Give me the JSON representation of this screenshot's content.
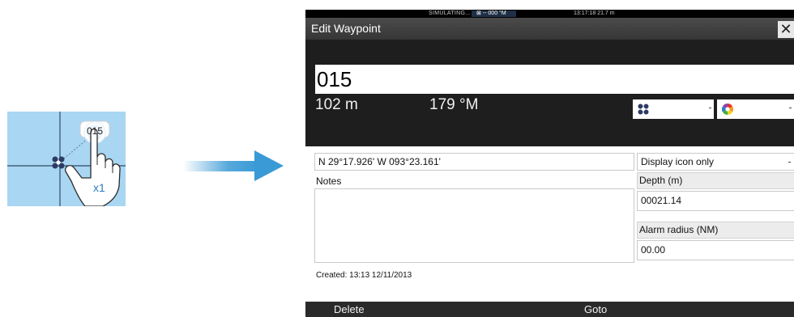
{
  "illustration": {
    "waypoint_label": "015",
    "tap_count": "x1"
  },
  "status_bar": {
    "mode": "SIMULATING...",
    "gps": "⊠ -- 000 °M",
    "time_depth": "13:17:18  21.7 m"
  },
  "dialog": {
    "title": "Edit Waypoint",
    "close_label": "✕",
    "name": "015",
    "distance": "102 m",
    "bearing": "179 °M",
    "icon_dropdown": {
      "icon": "waypoint-icon"
    },
    "color_dropdown": {
      "icon": "color-wheel-icon"
    },
    "position": "N 29°17.926'  W 093°23.161'",
    "notes_label": "Notes",
    "notes_value": "",
    "created": "Created: 13:13  12/11/2013",
    "display_mode": "Display icon only",
    "depth_label": "Depth (m)",
    "depth_value": "00021.14",
    "alarm_label": "Alarm radius (NM)",
    "alarm_value": "00.00"
  },
  "footer": {
    "delete_label": "Delete",
    "goto_label": "Goto"
  },
  "colors": {
    "screen_bg": "#1e1e1e",
    "chart_water": "#a9d6f2",
    "arrow": "#3a9ad5"
  }
}
